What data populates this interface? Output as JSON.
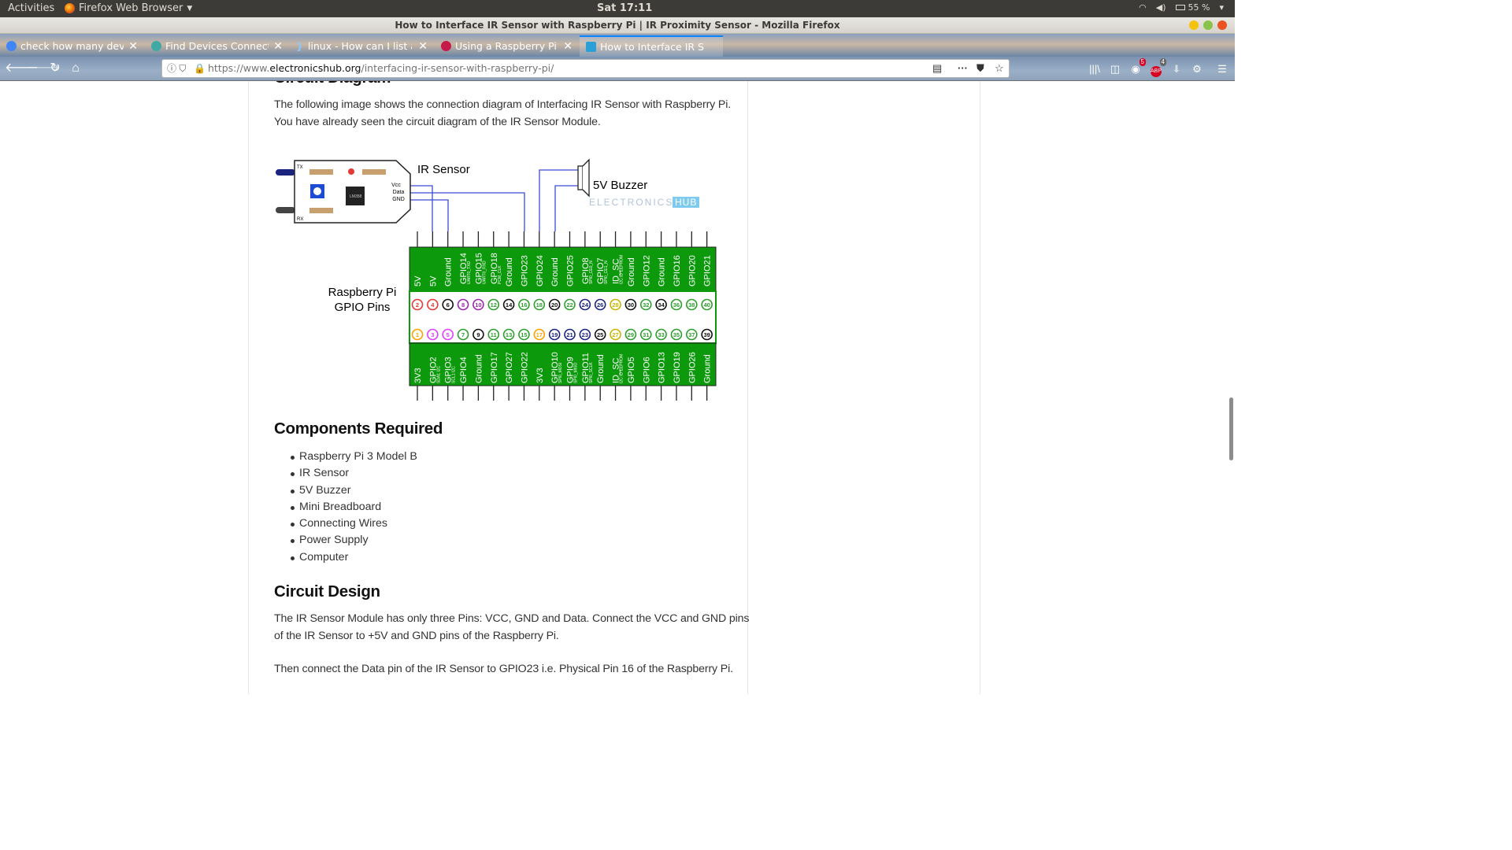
{
  "system": {
    "activities": "Activities",
    "app_name": "Firefox Web Browser",
    "clock": "Sat 17:11",
    "battery": "55 %"
  },
  "window": {
    "title": "How to Interface IR Sensor with Raspberry Pi | IR Proximity Sensor - Mozilla Firefox"
  },
  "tabs": [
    {
      "label": "check how many devices",
      "icon_color": "#4285f4"
    },
    {
      "label": "Find Devices Connected",
      "icon_color": "#3fa9a5"
    },
    {
      "label": "linux - How can I list all IP",
      "icon_color": "#2a6ebb"
    },
    {
      "label": "Using a Raspberry Pi dist",
      "icon_color": "#c51a4a"
    },
    {
      "label": "How to Interface IR Sens",
      "icon_color": "#2b9fd8"
    }
  ],
  "urlbar": {
    "prefix": "https://www.",
    "domain": "electronicshub.org",
    "path": "/interfacing-ir-sensor-with-raspberry-pi/"
  },
  "toolbar_badges": {
    "pocket_count": "5",
    "adblock_count": "4"
  },
  "article": {
    "cut_heading": "Circuit Diagram",
    "intro_p1": "The following image shows the connection diagram of Interfacing IR Sensor with Raspberry Pi.",
    "intro_p2": "You have already seen the circuit diagram of the IR Sensor Module.",
    "diagram": {
      "ir_label": "IR Sensor",
      "buzzer_label": "5V Buzzer",
      "watermark_a": "ELECTRONICS",
      "watermark_b": "HUB",
      "rpi_label_1": "Raspberry Pi",
      "rpi_label_2": "GPIO Pins",
      "module_pins": [
        "Vcc",
        "Data",
        "GND"
      ],
      "chip_label": "LM358",
      "tx": "TX",
      "rx": "RX",
      "top_pin_labels": [
        "5V",
        "5V",
        "Ground",
        "GPIO14",
        "GPIO15",
        "GPIO18",
        "Ground",
        "GPIO23",
        "GPIO24",
        "Ground",
        "GPIO25",
        "GPIO8",
        "GPIO7",
        "ID_SC",
        "Ground",
        "GPIO12",
        "Ground",
        "GPIO16",
        "GPIO20",
        "GPIO21"
      ],
      "top_pin_sublabels": [
        "",
        "",
        "",
        "UART0_TXD",
        "UART0_RXD",
        "PCM_CLK",
        "",
        "",
        "",
        "",
        "",
        "SPI0_CE0_N",
        "SPI0_CE1_N",
        "I2C ID EEPROM",
        "",
        "",
        "",
        "",
        "",
        ""
      ],
      "top_pin_numbers": [
        "2",
        "4",
        "6",
        "8",
        "10",
        "12",
        "14",
        "16",
        "18",
        "20",
        "22",
        "24",
        "26",
        "28",
        "30",
        "32",
        "34",
        "36",
        "38",
        "40"
      ],
      "bottom_pin_numbers": [
        "1",
        "3",
        "5",
        "7",
        "9",
        "11",
        "13",
        "15",
        "17",
        "19",
        "21",
        "23",
        "25",
        "27",
        "29",
        "31",
        "33",
        "35",
        "37",
        "39"
      ],
      "bottom_pin_labels": [
        "3V3",
        "GPIO2",
        "GPIO3",
        "GPIO4",
        "Ground",
        "GPIO17",
        "GPIO27",
        "GPIO22",
        "3V3",
        "GPIO10",
        "GPIO9",
        "GPIO11",
        "Ground",
        "ID_SC",
        "GPIO5",
        "GPIO6",
        "GPIO13",
        "GPIO19",
        "GPIO26",
        "Ground"
      ],
      "bottom_pin_sublabels": [
        "",
        "SDA1 I2C",
        "SCL1 I2C",
        "",
        "",
        "",
        "",
        "",
        "",
        "SPI0_MOSI",
        "SPI0_MISO",
        "SPI0_SCLK",
        "",
        "I2C ID EEPROM",
        "",
        "",
        "",
        "",
        "",
        ""
      ],
      "top_pin_colors": [
        "#e53935",
        "#e53935",
        "#111111",
        "#9c27b0",
        "#9c27b0",
        "#2e9e2e",
        "#111111",
        "#2e9e2e",
        "#2e9e2e",
        "#111111",
        "#2e9e2e",
        "#1a237e",
        "#1a237e",
        "#c8b400",
        "#111111",
        "#2e9e2e",
        "#111111",
        "#2e9e2e",
        "#2e9e2e",
        "#2e9e2e"
      ],
      "bottom_pin_colors": [
        "#ffa000",
        "#e040fb",
        "#e040fb",
        "#2e9e2e",
        "#111111",
        "#2e9e2e",
        "#2e9e2e",
        "#2e9e2e",
        "#ffa000",
        "#1a237e",
        "#1a237e",
        "#1a237e",
        "#111111",
        "#c8b400",
        "#2e9e2e",
        "#2e9e2e",
        "#2e9e2e",
        "#2e9e2e",
        "#2e9e2e",
        "#111111"
      ]
    },
    "components_heading": "Components Required",
    "components": [
      "Raspberry Pi 3 Model B",
      "IR Sensor",
      "5V Buzzer",
      "Mini Breadboard",
      "Connecting Wires",
      "Power Supply",
      "Computer"
    ],
    "design_heading": "Circuit Design",
    "design_p1a": "The IR Sensor Module has only three Pins: VCC, GND and Data. Connect the VCC and GND pins",
    "design_p1b": "of the IR Sensor to +5V and GND pins of the Raspberry Pi.",
    "design_p2": "Then connect the Data pin of the IR Sensor to GPIO23 i.e. Physical Pin 16 of the Raspberry Pi."
  }
}
